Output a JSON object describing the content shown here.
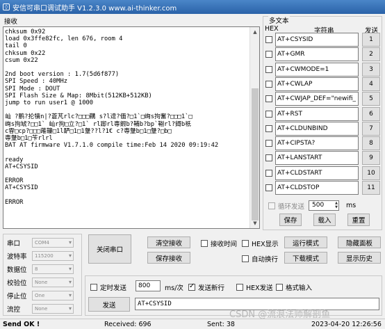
{
  "window": {
    "title": "安信可串口调试助手 V1.2.3.0    www.ai-thinker.com"
  },
  "receive": {
    "label": "接收",
    "text": "chksum 0x92\nload 0x3ffe82fc, len 676, room 4\ntail 0\nchksum 0x22\ncsum 0x22\n\n2nd boot version : 1.7(5d6f877)\nSPI Speed : 40MHz\nSPI Mode : DOUT\nSPI Flash Size & Map: 8Mbit(512KB+512KB)\njump to run user1 @ 1000\n\n屾 ?鹏?抡犢n|?蒼芃rlc?□□□鞲 s?l逹?偭?□1`□峋s拘奮?□□□1`□\n峋s拘虓?□□1` 屾r拘□立?□1` rl踋rl専鍜b?鞴b?bp`鞩rl?鎶b祇\nc雸□cp?□□□蓶鞻□1l酽□1□1鞶??l?1€ c?専鞶b□1□鞶?□b□\n専鞶b□1□苄rlrl\nBAT AT firmware V1.7.1.0 compile time:Feb 14 2020 09:19:42\n\nready\nAT+CSYSID\n\nERROR\nAT+CSYSID\n\nERROR"
  },
  "multi": {
    "title": "多文本",
    "hex_label": "HEX",
    "string_label": "字符串",
    "send_label": "发送",
    "items": [
      {
        "cmd": "AT+CSYSID",
        "num": "1"
      },
      {
        "cmd": "AT+GMR",
        "num": "2"
      },
      {
        "cmd": "AT+CWMODE=1",
        "num": "3"
      },
      {
        "cmd": "AT+CWLAP",
        "num": "4"
      },
      {
        "cmd": "AT+CWJAP_DEF=\"newifi_",
        "num": "5"
      },
      {
        "cmd": "AT+RST",
        "num": "6"
      },
      {
        "cmd": "AT+CLDUNBIND",
        "num": "7"
      },
      {
        "cmd": "AT+CIPSTA?",
        "num": "8"
      },
      {
        "cmd": "AT+LANSTART",
        "num": "9"
      },
      {
        "cmd": "AT+CLDSTART",
        "num": "10"
      },
      {
        "cmd": "AT+CLDSTOP",
        "num": "11"
      }
    ],
    "loop_label": "循环发送",
    "loop_value": "500",
    "loop_unit": "ms",
    "save": "保存",
    "load": "载入",
    "reset": "重置"
  },
  "serial": {
    "port_label": "串口",
    "port_value": "COM4",
    "baud_label": "波特率",
    "baud_value": "115200",
    "data_label": "数据位",
    "data_value": "8",
    "parity_label": "校验位",
    "parity_value": "None",
    "stop_label": "停止位",
    "stop_value": "One",
    "flow_label": "流控",
    "flow_value": "None"
  },
  "controls": {
    "close_port": "关闭串口",
    "clear_recv": "清空接收",
    "save_recv": "保存接收",
    "recv_time": "接收时间",
    "hex_display": "HEX显示",
    "run_mode": "运行模式",
    "hide_panel": "隐藏面板",
    "auto_wrap": "自动换行",
    "download_mode": "下载模式",
    "show_history": "显示历史"
  },
  "send": {
    "timed_label": "定时发送",
    "interval": "800",
    "interval_unit": "ms/次",
    "newline_label": "发送新行",
    "hex_send": "HEX发送",
    "format_input": "格式输入",
    "send_button": "发送",
    "input_value": "AT+CSYSID"
  },
  "status": {
    "message": "Send OK !",
    "received": "Received: 696",
    "sent": "Sent: 38",
    "datetime": "2023-04-20 12:26:56"
  },
  "watermark": "CSDN @流浪法师解剖鱼"
}
